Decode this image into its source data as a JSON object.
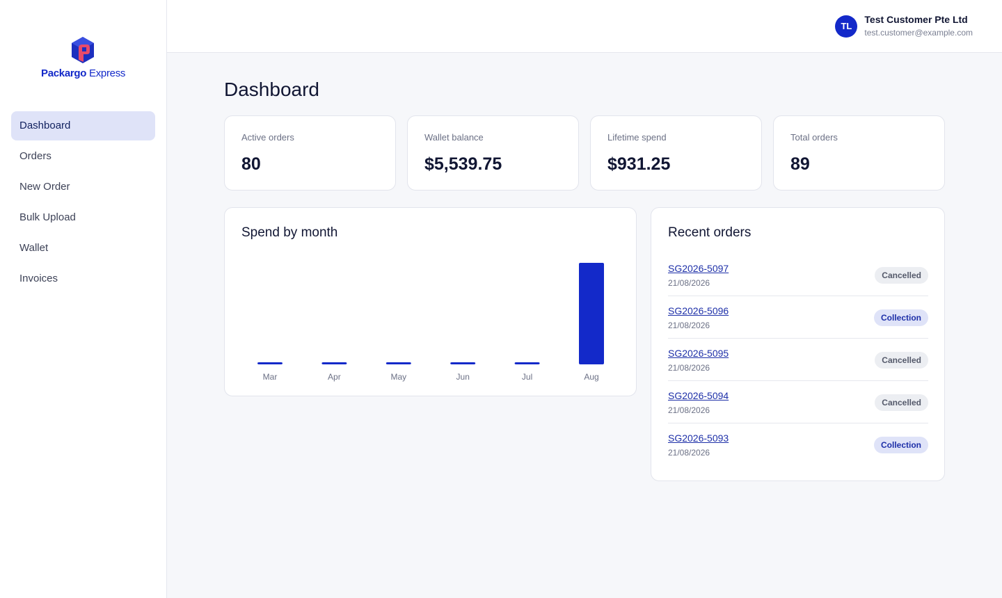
{
  "brand": {
    "name_bold": "Packargo",
    "name_light": "Express",
    "accent": "#1329c9",
    "logo_accent_pink": "#e84a6a"
  },
  "sidebar": {
    "items": [
      {
        "label": "Dashboard",
        "active": true
      },
      {
        "label": "Orders"
      },
      {
        "label": "New Order"
      },
      {
        "label": "Bulk Upload"
      },
      {
        "label": "Wallet"
      },
      {
        "label": "Invoices"
      }
    ]
  },
  "header": {
    "user": {
      "initials": "TL",
      "name": "Test Customer Pte Ltd",
      "email": "test.customer@example.com"
    }
  },
  "page_title": "Dashboard",
  "stats": [
    {
      "label": "Active orders",
      "value": "80"
    },
    {
      "label": "Wallet balance",
      "value": "$5,539.75"
    },
    {
      "label": "Lifetime spend",
      "value": "$931.25"
    },
    {
      "label": "Total orders",
      "value": "89"
    }
  ],
  "spend_chart": {
    "title": "Spend by month"
  },
  "chart_data": {
    "type": "bar",
    "title": "Spend by month",
    "categories": [
      "Mar",
      "Apr",
      "May",
      "Jun",
      "Jul",
      "Aug"
    ],
    "values": [
      0,
      0,
      0,
      0,
      0,
      931.25
    ],
    "xlabel": "",
    "ylabel": "",
    "bar_color": "#1329c9",
    "grid": false
  },
  "recent_orders": {
    "title": "Recent orders",
    "items": [
      {
        "id": "SG2026-5097",
        "date": "21/08/2026",
        "status": "Cancelled",
        "status_key": "cancelled"
      },
      {
        "id": "SG2026-5096",
        "date": "21/08/2026",
        "status": "Collection",
        "status_key": "collection"
      },
      {
        "id": "SG2026-5095",
        "date": "21/08/2026",
        "status": "Cancelled",
        "status_key": "cancelled"
      },
      {
        "id": "SG2026-5094",
        "date": "21/08/2026",
        "status": "Cancelled",
        "status_key": "cancelled"
      },
      {
        "id": "SG2026-5093",
        "date": "21/08/2026",
        "status": "Collection",
        "status_key": "collection"
      }
    ]
  }
}
